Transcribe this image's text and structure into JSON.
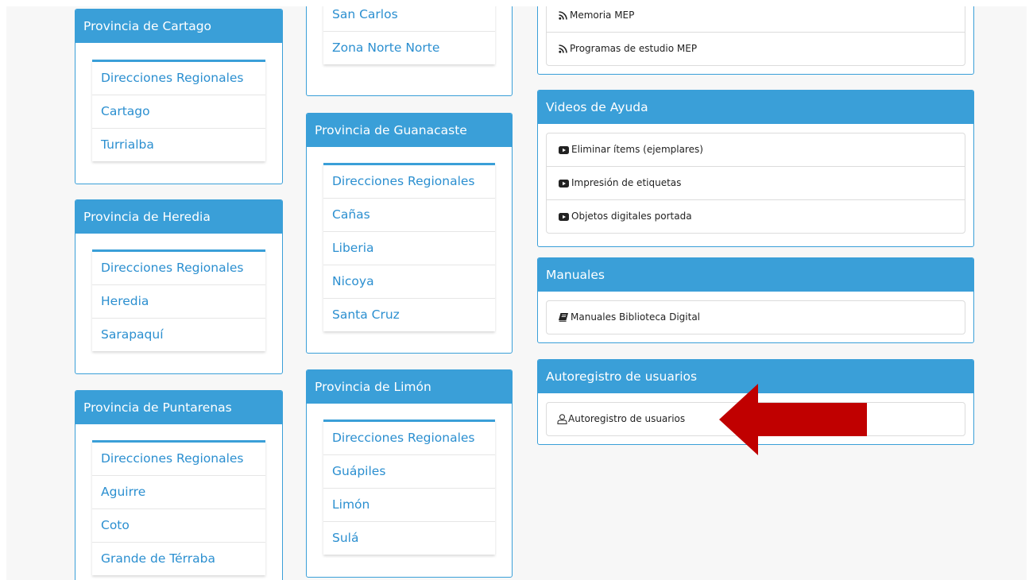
{
  "col1": [
    {
      "title": "Provincia de Cartago",
      "items": [
        "Direcciones Regionales",
        "Cartago",
        "Turrialba"
      ]
    },
    {
      "title": "Provincia de Heredia",
      "items": [
        "Direcciones Regionales",
        "Heredia",
        "Sarapaquí"
      ]
    },
    {
      "title": "Provincia de Puntarenas",
      "items": [
        "Direcciones Regionales",
        "Aguirre",
        "Coto",
        "Grande de Térraba"
      ]
    }
  ],
  "col2": [
    {
      "title": "",
      "items": [
        "San Carlos",
        "Zona Norte Norte"
      ]
    },
    {
      "title": "Provincia de Guanacaste",
      "items": [
        "Direcciones Regionales",
        "Cañas",
        "Liberia",
        "Nicoya",
        "Santa Cruz"
      ]
    },
    {
      "title": "Provincia de Limón",
      "items": [
        "Direcciones Regionales",
        "Guápiles",
        "Limón",
        "Sulá"
      ]
    }
  ],
  "col3": [
    {
      "title": "",
      "icon": "rss-icon",
      "links": [
        "Memoria MEP",
        "Programas de estudio MEP"
      ]
    },
    {
      "title": "Videos de Ayuda",
      "icon": "youtube-icon",
      "links": [
        "Eliminar ítems (ejemplares)",
        "Impresión de etiquetas",
        "Objetos digitales portada"
      ]
    },
    {
      "title": "Manuales",
      "icon": "book-icon",
      "links": [
        "Manuales Biblioteca Digital"
      ]
    },
    {
      "title": "Autoregistro de usuarios",
      "icon": "user-icon",
      "links": [
        "Autoregistro de usuarios"
      ]
    }
  ],
  "colors": {
    "primary": "#3a9fd8",
    "link": "#2b8fd0",
    "arrow": "#c00000"
  }
}
